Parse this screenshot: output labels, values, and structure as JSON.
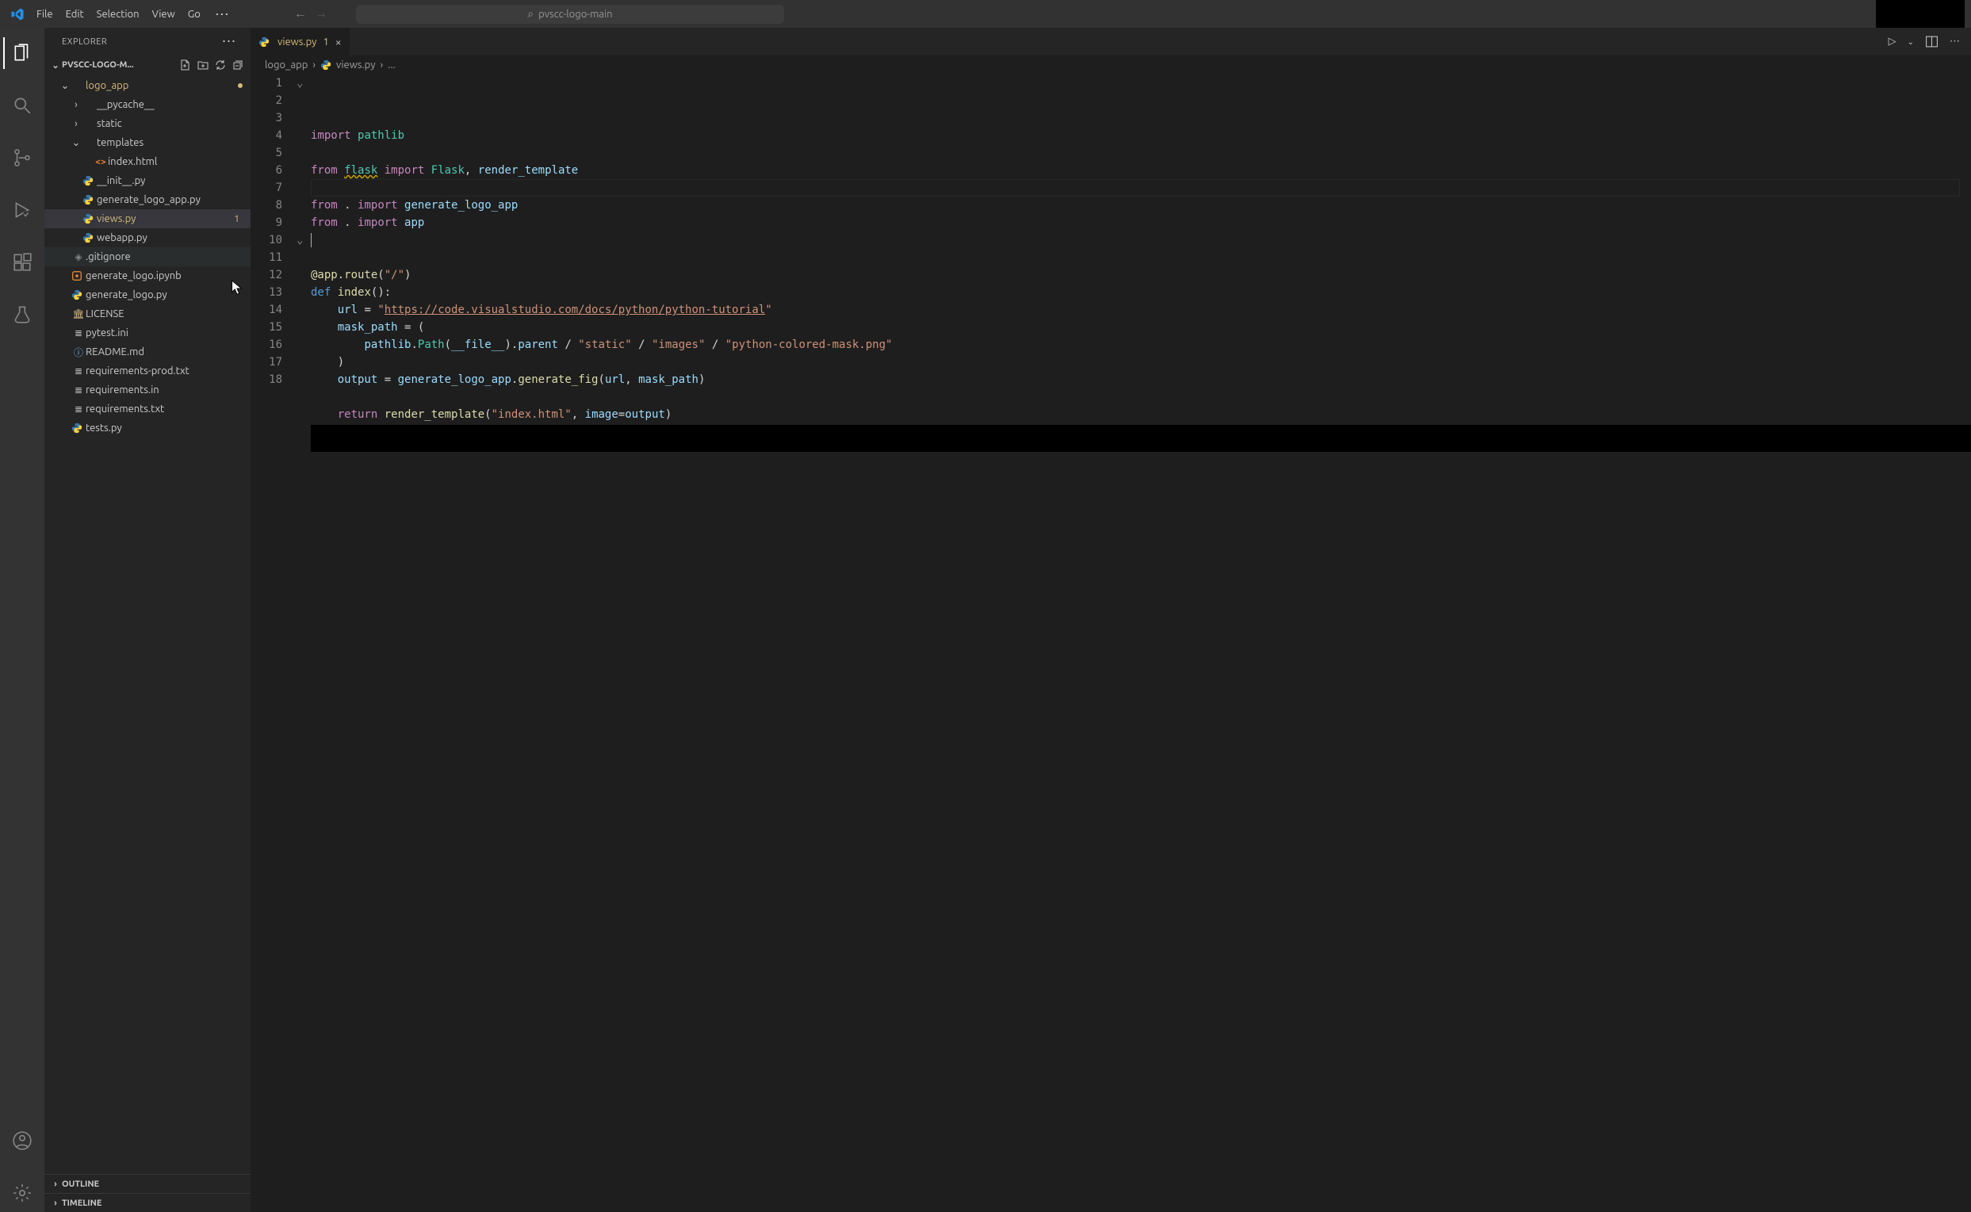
{
  "titlebar": {
    "menu": [
      "File",
      "Edit",
      "Selection",
      "View",
      "Go"
    ],
    "search_text": "pvscc-logo-main"
  },
  "activity_bar": {
    "items": [
      {
        "id": "explorer",
        "active": true
      },
      {
        "id": "search",
        "active": false
      },
      {
        "id": "scm",
        "active": false
      },
      {
        "id": "run",
        "active": false
      },
      {
        "id": "extensions",
        "active": false
      },
      {
        "id": "testing",
        "active": false
      }
    ],
    "bottom_items": [
      {
        "id": "accounts"
      },
      {
        "id": "settings"
      }
    ]
  },
  "sidebar": {
    "header": "EXPLORER",
    "root": "PVSCC-LOGO-M...",
    "tree": [
      {
        "type": "folder",
        "name": "logo_app",
        "depth": 0,
        "open": true,
        "modified": true,
        "twist": "v"
      },
      {
        "type": "folder",
        "name": "__pycache__",
        "depth": 1,
        "open": false,
        "twist": ">"
      },
      {
        "type": "folder",
        "name": "static",
        "depth": 1,
        "open": false,
        "twist": ">"
      },
      {
        "type": "folder",
        "name": "templates",
        "depth": 1,
        "open": true,
        "twist": "v"
      },
      {
        "type": "file",
        "name": "index.html",
        "depth": 2,
        "icon": "html"
      },
      {
        "type": "file",
        "name": "__init__.py",
        "depth": 1,
        "icon": "python"
      },
      {
        "type": "file",
        "name": "generate_logo_app.py",
        "depth": 1,
        "icon": "python"
      },
      {
        "type": "file",
        "name": "views.py",
        "depth": 1,
        "icon": "python",
        "modified": true,
        "badge": "1",
        "active": true
      },
      {
        "type": "file",
        "name": "webapp.py",
        "depth": 1,
        "icon": "python"
      },
      {
        "type": "file",
        "name": ".gitignore",
        "depth": 0,
        "icon": "git",
        "hover": true
      },
      {
        "type": "file",
        "name": "generate_logo.ipynb",
        "depth": 0,
        "icon": "notebook"
      },
      {
        "type": "file",
        "name": "generate_logo.py",
        "depth": 0,
        "icon": "python"
      },
      {
        "type": "file",
        "name": "LICENSE",
        "depth": 0,
        "icon": "license"
      },
      {
        "type": "file",
        "name": "pytest.ini",
        "depth": 0,
        "icon": "ini"
      },
      {
        "type": "file",
        "name": "README.md",
        "depth": 0,
        "icon": "info"
      },
      {
        "type": "file",
        "name": "requirements-prod.txt",
        "depth": 0,
        "icon": "lines"
      },
      {
        "type": "file",
        "name": "requirements.in",
        "depth": 0,
        "icon": "lines"
      },
      {
        "type": "file",
        "name": "requirements.txt",
        "depth": 0,
        "icon": "lines"
      },
      {
        "type": "file",
        "name": "tests.py",
        "depth": 0,
        "icon": "python"
      }
    ],
    "footer_sections": [
      "OUTLINE",
      "TIMELINE"
    ]
  },
  "tabs": [
    {
      "file": "views.py",
      "badge": "1",
      "icon": "python",
      "dirty": false,
      "active": true
    }
  ],
  "breadcrumb": [
    "logo_app",
    "views.py",
    "..."
  ],
  "editor": {
    "current_line": 7,
    "lines": [
      {
        "n": 1,
        "fold": "v",
        "html": "<span class='kw'>import</span> <span class='teal'>pathlib</span>"
      },
      {
        "n": 2,
        "html": ""
      },
      {
        "n": 3,
        "html": "<span class='kw'>from</span> <span class='teal underline-wavy'>flask</span> <span class='kw'>import</span> <span class='teal'>Flask</span><span class='pale'>,</span> <span class='var'>render_template</span>"
      },
      {
        "n": 4,
        "html": ""
      },
      {
        "n": 5,
        "html": "<span class='kw'>from</span> <span class='pale'>.</span> <span class='kw'>import</span> <span class='var'>generate_logo_app</span>"
      },
      {
        "n": 6,
        "html": "<span class='kw'>from</span> <span class='pale'>.</span> <span class='kw'>import</span> <span class='var'>app</span>"
      },
      {
        "n": 7,
        "html": "<span class='cursor'></span>"
      },
      {
        "n": 8,
        "html": ""
      },
      {
        "n": 9,
        "html": "<span class='fn'>@app.route</span><span class='pale'>(</span><span class='str'>\"/\"</span><span class='pale'>)</span>"
      },
      {
        "n": 10,
        "fold": "v",
        "html": "<span class='blue-kw'>def</span> <span class='fn'>index</span><span class='pale'>():</span>"
      },
      {
        "n": 11,
        "html": "    <span class='var'>url</span> <span class='op'>=</span> <span class='str'>\"<span class='underline-link'>https://code.visualstudio.com/docs/python/python-tutorial</span>\"</span>"
      },
      {
        "n": 12,
        "html": "    <span class='var'>mask_path</span> <span class='op'>=</span> <span class='pale'>(</span>"
      },
      {
        "n": 13,
        "html": "        <span class='var'>pathlib</span><span class='pale'>.</span><span class='teal'>Path</span><span class='pale'>(</span><span class='var'>__file__</span><span class='pale'>).</span><span class='var'>parent</span> <span class='op'>/</span> <span class='str'>\"static\"</span> <span class='op'>/</span> <span class='str'>\"images\"</span> <span class='op'>/</span> <span class='str'>\"python-colored-mask.png\"</span>"
      },
      {
        "n": 14,
        "html": "    <span class='pale'>)</span>"
      },
      {
        "n": 15,
        "html": "    <span class='var'>output</span> <span class='op'>=</span> <span class='var'>generate_logo_app</span><span class='pale'>.</span><span class='fn'>generate_fig</span><span class='pale'>(</span><span class='var'>url</span><span class='pale'>,</span> <span class='var'>mask_path</span><span class='pale'>)</span>"
      },
      {
        "n": 16,
        "html": ""
      },
      {
        "n": 17,
        "html": "    <span class='kw'>return</span> <span class='fn'>render_template</span><span class='pale'>(</span><span class='str'>\"index.html\"</span><span class='pale'>,</span> <span class='var'>image</span><span class='op'>=</span><span class='var'>output</span><span class='pale'>)</span>"
      },
      {
        "n": 18,
        "html": ""
      }
    ]
  },
  "icons": {
    "html": "&lt;&gt;",
    "python": "py",
    "git": "◈",
    "notebook": "nb",
    "license": "⚖",
    "ini": "≡",
    "info": "ⓘ",
    "lines": "≣"
  },
  "colors": {
    "python_icon": "#3776ab",
    "html_icon": "#e37933",
    "license_icon": "#d7ba7d",
    "notebook_icon": "#f28d35",
    "info_icon": "#75beff",
    "git_icon": "#848484",
    "lines_icon": "#c5c5c5"
  }
}
